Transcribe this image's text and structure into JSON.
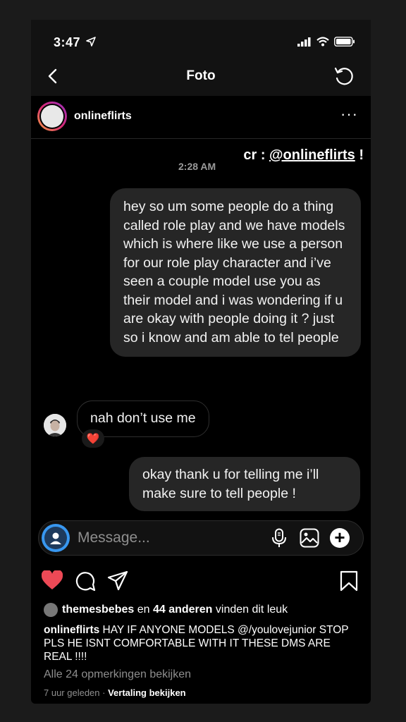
{
  "status": {
    "time": "3:47"
  },
  "nav": {
    "title": "Foto"
  },
  "post": {
    "username": "onlineflirts",
    "more": "···"
  },
  "photo": {
    "credit_prefix": "cr : ",
    "credit_handle": "@onlineflirts",
    "credit_suffix": " !",
    "timestamp": "2:28 AM",
    "messages": [
      {
        "text": "hey so um some people do a thing called role play and we have models which is where like we use a person for our role play character and i’ve seen a couple model use you as their model and i was wondering if u are okay with people doing it ? just so i know and am able to tel people"
      },
      {
        "text": "nah don’t use me",
        "reaction": "❤️"
      },
      {
        "text": "okay thank u for telling me i’ll make sure to tell people !"
      }
    ],
    "composer_placeholder": "Message..."
  },
  "likes": {
    "user": "themesbebes",
    "middle": " en ",
    "count": "44 anderen",
    "suffix": " vinden dit leuk"
  },
  "caption": {
    "user": "onlineflirts",
    "text": " HAY IF ANYONE MODELS @/youlovejunior STOP PLS HE ISNT COMFORTABLE WITH IT THESE DMS ARE REAL !!!!"
  },
  "comments_link": "Alle 24 opmerkingen bekijken",
  "meta": {
    "age": "7 uur geleden",
    "sep": " · ",
    "translate": "Vertaling bekijken"
  },
  "colors": {
    "like": "#ed4956",
    "bg": "#000000",
    "bubble": "#262626"
  },
  "icons": [
    "location-arrow-icon",
    "signal-icon",
    "wifi-icon",
    "battery-icon",
    "back-chevron-icon",
    "refresh-icon",
    "more-icon",
    "camera-icon",
    "mic-icon",
    "gallery-icon",
    "plus-icon",
    "heart-icon",
    "comment-icon",
    "share-icon",
    "bookmark-icon"
  ]
}
